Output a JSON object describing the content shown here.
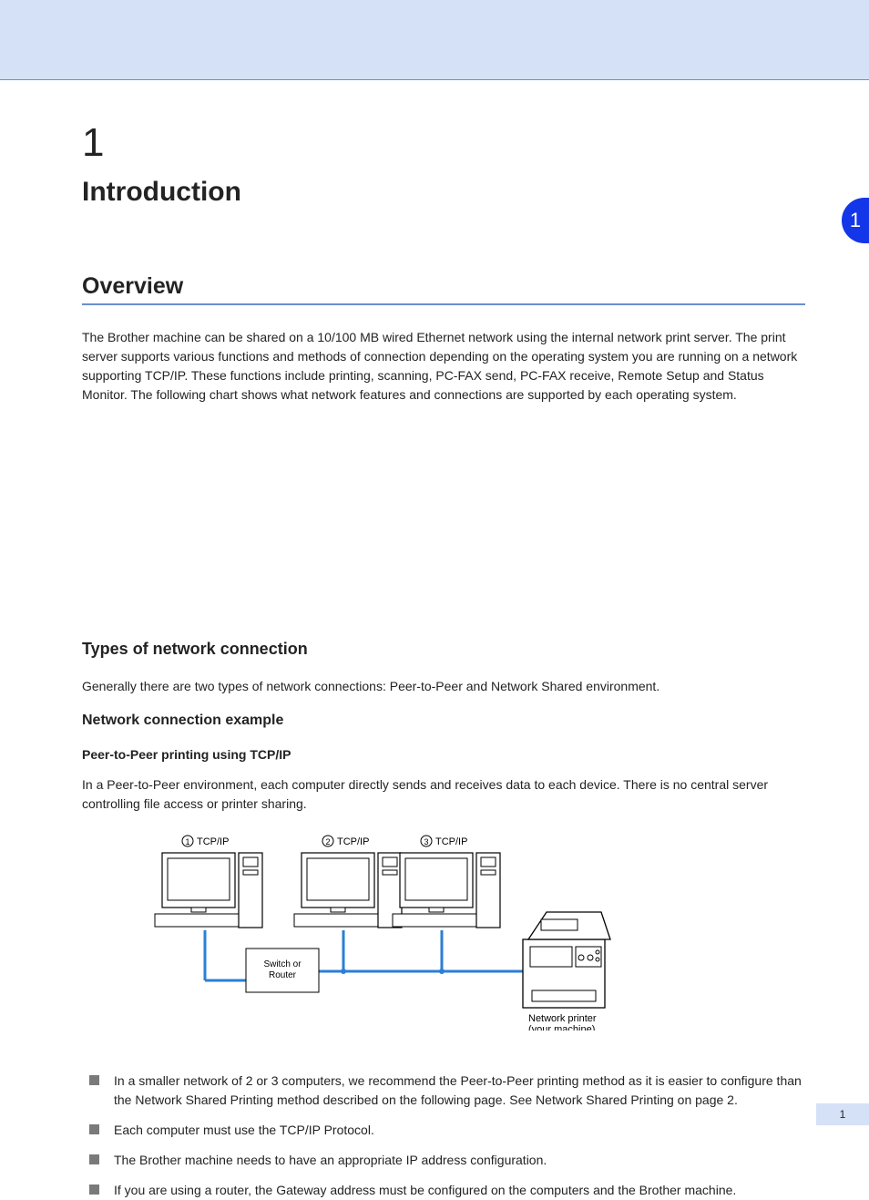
{
  "side_tab": "1",
  "chapter": {
    "number": "1",
    "title": "Introduction"
  },
  "section": {
    "title": "Overview"
  },
  "overview_paragraph": "The Brother machine can be shared on a 10/100 MB wired Ethernet network using the internal network print server. The print server supports various functions and methods of connection depending on the operating system you are running on a network supporting TCP/IP. These functions include printing, scanning, PC-FAX send, PC-FAX receive, Remote Setup and Status Monitor. The following chart shows what network features and connections are supported by each operating system.",
  "subsection": {
    "title": "Types of network connection"
  },
  "types_paragraph": "Generally there are two types of network connections: Peer-to-Peer and Network Shared environment.",
  "example": {
    "title": "Network connection example",
    "heading": "Peer-to-Peer printing using TCP/IP",
    "paragraph": "In a Peer-to-Peer environment, each computer directly sends and receives data to each device. There is no central server controlling file access or printer sharing."
  },
  "bullets": [
    "In a smaller network of 2 or 3 computers, we recommend the Peer-to-Peer printing method as it is easier to configure than the Network Shared Printing method described on the following page. See Network Shared Printing on page 2.",
    "Each computer must use the TCP/IP Protocol.",
    "The Brother machine needs to have an appropriate IP address configuration.",
    "If you are using a router, the Gateway address must be configured on the computers and the Brother machine."
  ],
  "italic_ref": "Network Shared Printing",
  "diagram_labels": {
    "tcpip1": "TCP/IP",
    "tcpip2": "TCP/IP",
    "tcpip3": "TCP/IP",
    "switch": "Switch or Router",
    "printer": "Network printer (your machine)"
  },
  "page_number": "1"
}
